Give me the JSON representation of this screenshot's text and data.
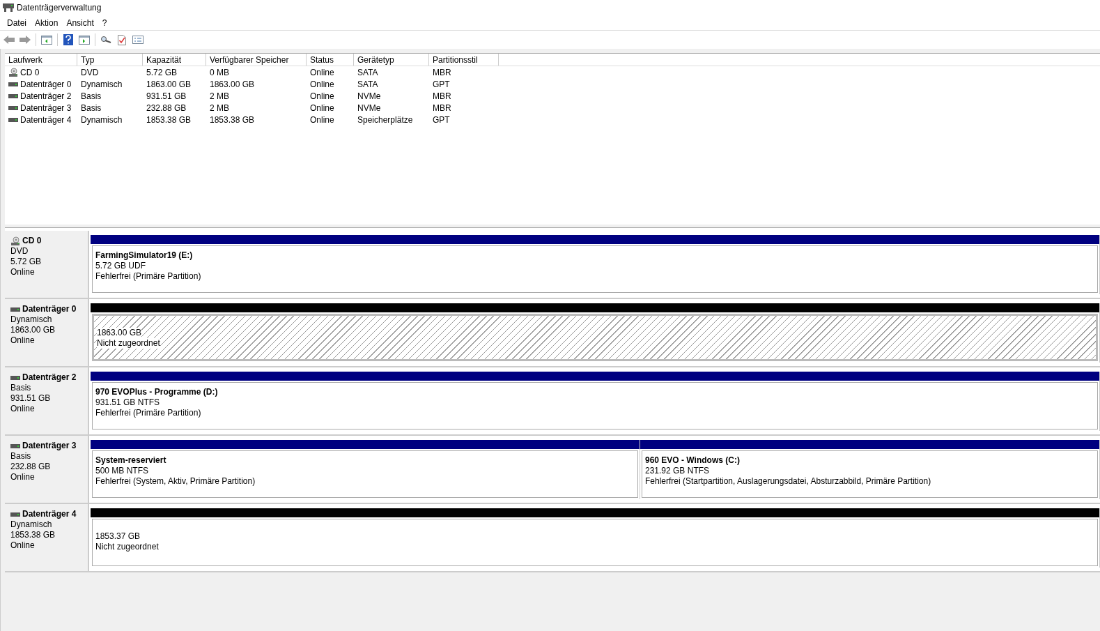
{
  "window": {
    "title": "Datenträgerverwaltung"
  },
  "menu": [
    "Datei",
    "Aktion",
    "Ansicht",
    "?"
  ],
  "table": {
    "columns": [
      "Laufwerk",
      "Typ",
      "Kapazität",
      "Verfügbarer Speicher",
      "Status",
      "Gerätetyp",
      "Partitionsstil"
    ],
    "rows": [
      {
        "kind": "cd",
        "cells": [
          "CD 0",
          "DVD",
          "5.72 GB",
          "0 MB",
          "Online",
          "SATA",
          "MBR"
        ]
      },
      {
        "kind": "disk",
        "cells": [
          "Datenträger 0",
          "Dynamisch",
          "1863.00 GB",
          "1863.00 GB",
          "Online",
          "SATA",
          "GPT"
        ]
      },
      {
        "kind": "disk",
        "cells": [
          "Datenträger 2",
          "Basis",
          "931.51 GB",
          "2 MB",
          "Online",
          "NVMe",
          "MBR"
        ]
      },
      {
        "kind": "disk",
        "cells": [
          "Datenträger 3",
          "Basis",
          "232.88 GB",
          "2 MB",
          "Online",
          "NVMe",
          "MBR"
        ]
      },
      {
        "kind": "disk",
        "cells": [
          "Datenträger 4",
          "Dynamisch",
          "1853.38 GB",
          "1853.38 GB",
          "Online",
          "Speicherplätze",
          "GPT"
        ]
      }
    ]
  },
  "disks": [
    {
      "kind": "cd",
      "name": "CD 0",
      "type": "DVD",
      "size": "5.72 GB",
      "status": "Online",
      "partitions": [
        {
          "kind": "primary",
          "selected": false,
          "title": "FarmingSimulator19  (E:)",
          "lines": [
            "5.72 GB UDF",
            "Fehlerfrei (Primäre Partition)"
          ]
        }
      ]
    },
    {
      "kind": "disk",
      "name": "Datenträger 0",
      "type": "Dynamisch",
      "size": "1863.00 GB",
      "status": "Online",
      "partitions": [
        {
          "kind": "unallocated",
          "selected": true,
          "lines": [
            "1863.00 GB",
            "Nicht zugeordnet"
          ]
        }
      ]
    },
    {
      "kind": "disk",
      "name": "Datenträger 2",
      "type": "Basis",
      "size": "931.51 GB",
      "status": "Online",
      "partitions": [
        {
          "kind": "primary",
          "selected": false,
          "title": "970 EVOPlus - Programme  (D:)",
          "lines": [
            "931.51 GB NTFS",
            "Fehlerfrei (Primäre Partition)"
          ]
        }
      ]
    },
    {
      "kind": "disk",
      "name": "Datenträger 3",
      "type": "Basis",
      "size": "232.88 GB",
      "status": "Online",
      "partitions": [
        {
          "kind": "primary",
          "selected": false,
          "title": "System-reserviert",
          "lines": [
            "500 MB NTFS",
            "Fehlerfrei (System, Aktiv, Primäre Partition)"
          ]
        },
        {
          "kind": "primary",
          "selected": false,
          "title": "960 EVO - Windows  (C:)",
          "lines": [
            "231.92 GB NTFS",
            "Fehlerfrei (Startpartition, Auslagerungsdatei, Absturzabbild, Primäre Partition)"
          ]
        }
      ]
    },
    {
      "kind": "disk",
      "name": "Datenträger 4",
      "type": "Dynamisch",
      "size": "1853.38 GB",
      "status": "Online",
      "partitions": [
        {
          "kind": "unallocated",
          "selected": false,
          "lines": [
            "1853.37 GB",
            "Nicht zugeordnet"
          ]
        }
      ]
    }
  ]
}
